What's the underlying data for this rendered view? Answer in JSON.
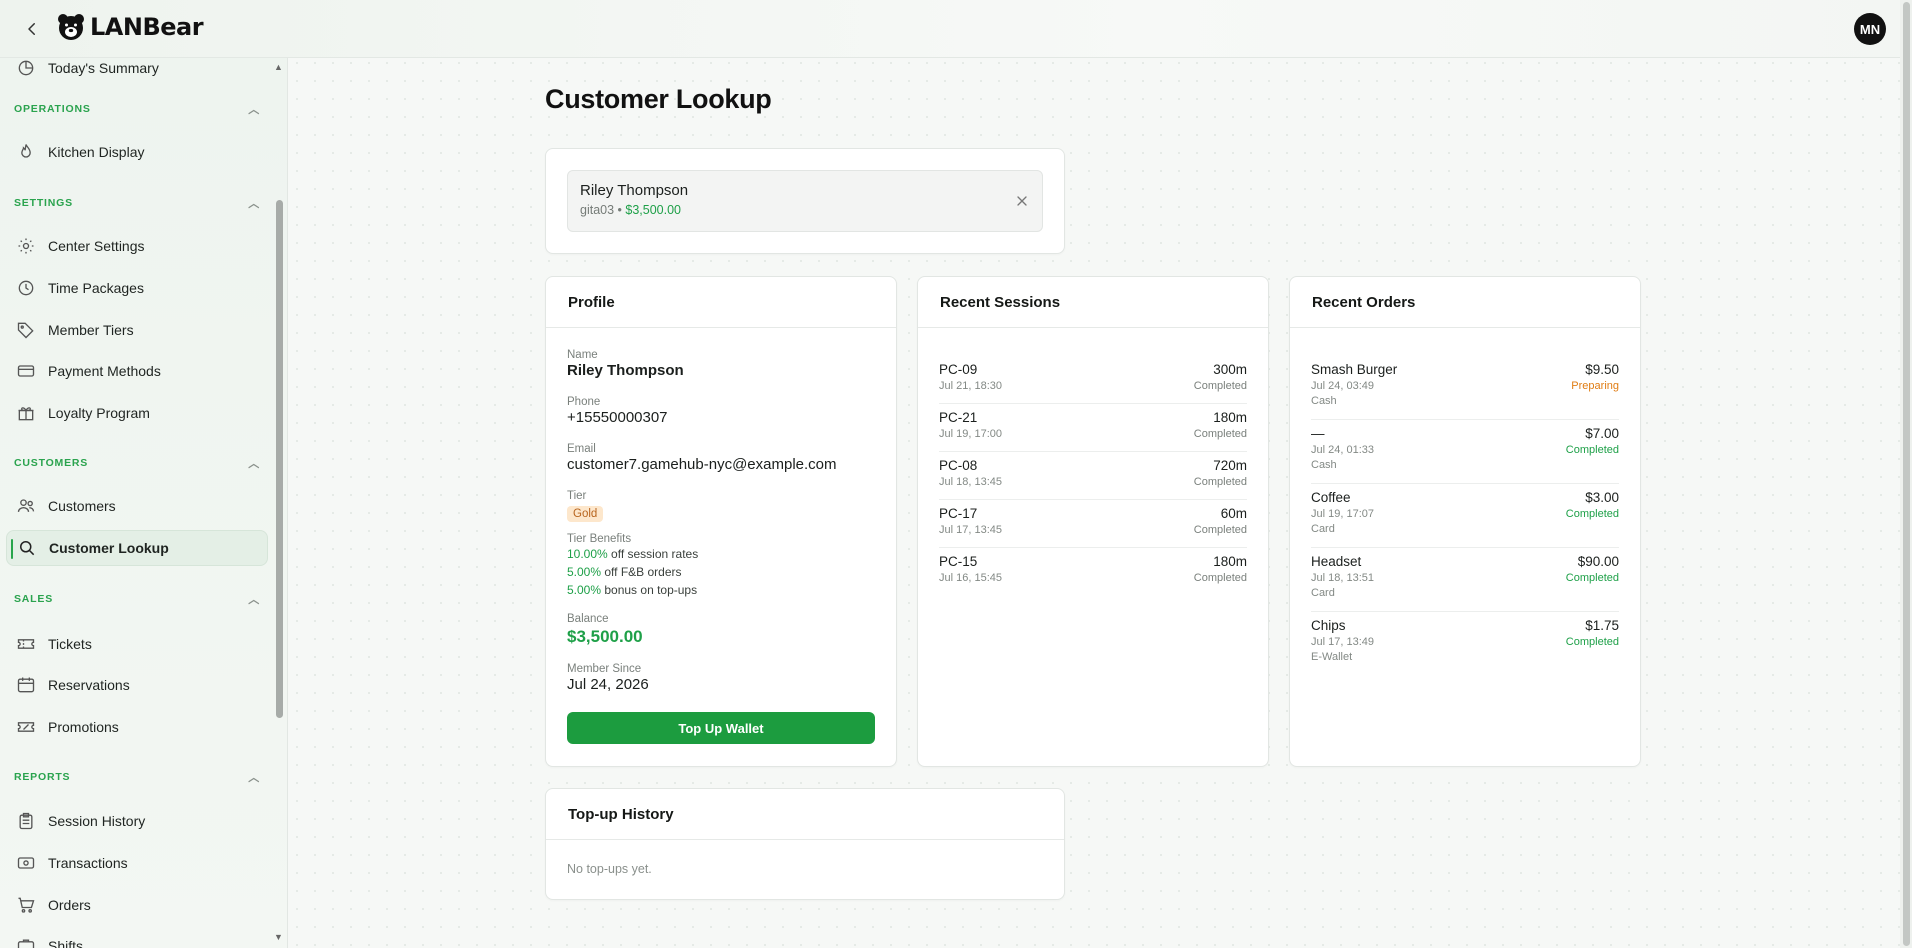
{
  "topbar": {
    "logo_text": "LANBear",
    "avatar_initials": "MN"
  },
  "sidebar": {
    "partial_item": "Today's Summary",
    "sections": {
      "operations": "OPERATIONS",
      "settings": "SETTINGS",
      "customers": "CUSTOMERS",
      "sales": "SALES",
      "reports": "REPORTS"
    },
    "items": {
      "kitchen_display": "Kitchen Display",
      "center_settings": "Center Settings",
      "time_packages": "Time Packages",
      "member_tiers": "Member Tiers",
      "payment_methods": "Payment Methods",
      "loyalty_program": "Loyalty Program",
      "customers": "Customers",
      "customer_lookup": "Customer Lookup",
      "tickets": "Tickets",
      "reservations": "Reservations",
      "promotions": "Promotions",
      "session_history": "Session History",
      "transactions": "Transactions",
      "orders": "Orders",
      "shifts": "Shifts"
    }
  },
  "page": {
    "title": "Customer Lookup"
  },
  "search": {
    "name": "Riley Thompson",
    "username": "gita03",
    "separator": " • ",
    "balance": "$3,500.00"
  },
  "profile": {
    "header": "Profile",
    "name_label": "Name",
    "name": "Riley Thompson",
    "phone_label": "Phone",
    "phone": "+15550000307",
    "email_label": "Email",
    "email": "customer7.gamehub-nyc@example.com",
    "tier_label": "Tier",
    "tier": "Gold",
    "benefits_label": "Tier Benefits",
    "benefits": [
      {
        "pct": "10.00%",
        "text": " off session rates"
      },
      {
        "pct": "5.00%",
        "text": " off F&B orders"
      },
      {
        "pct": "5.00%",
        "text": " bonus on top-ups"
      }
    ],
    "balance_label": "Balance",
    "balance": "$3,500.00",
    "member_since_label": "Member Since",
    "member_since": "Jul 24, 2026",
    "topup_button": "Top Up Wallet"
  },
  "sessions": {
    "header": "Recent Sessions",
    "rows": [
      {
        "pc": "PC-09",
        "date": "Jul 21, 18:30",
        "duration": "300m",
        "status": "Completed"
      },
      {
        "pc": "PC-21",
        "date": "Jul 19, 17:00",
        "duration": "180m",
        "status": "Completed"
      },
      {
        "pc": "PC-08",
        "date": "Jul 18, 13:45",
        "duration": "720m",
        "status": "Completed"
      },
      {
        "pc": "PC-17",
        "date": "Jul 17, 13:45",
        "duration": "60m",
        "status": "Completed"
      },
      {
        "pc": "PC-15",
        "date": "Jul 16, 15:45",
        "duration": "180m",
        "status": "Completed"
      }
    ]
  },
  "orders": {
    "header": "Recent Orders",
    "rows": [
      {
        "item": "Smash Burger",
        "date": "Jul 24, 03:49",
        "method": "Cash",
        "amount": "$9.50",
        "status": "Preparing"
      },
      {
        "item": "—",
        "date": "Jul 24, 01:33",
        "method": "Cash",
        "amount": "$7.00",
        "status": "Completed"
      },
      {
        "item": "Coffee",
        "date": "Jul 19, 17:07",
        "method": "Card",
        "amount": "$3.00",
        "status": "Completed"
      },
      {
        "item": "Headset",
        "date": "Jul 18, 13:51",
        "method": "Card",
        "amount": "$90.00",
        "status": "Completed"
      },
      {
        "item": "Chips",
        "date": "Jul 17, 13:49",
        "method": "E-Wallet",
        "amount": "$1.75",
        "status": "Completed"
      }
    ]
  },
  "topups": {
    "header": "Top-up History",
    "empty": "No top-ups yet."
  },
  "colors": {
    "accent": "#1c9c3f",
    "preparing": "#e07d14",
    "tier_badge": "#fde7cc"
  }
}
